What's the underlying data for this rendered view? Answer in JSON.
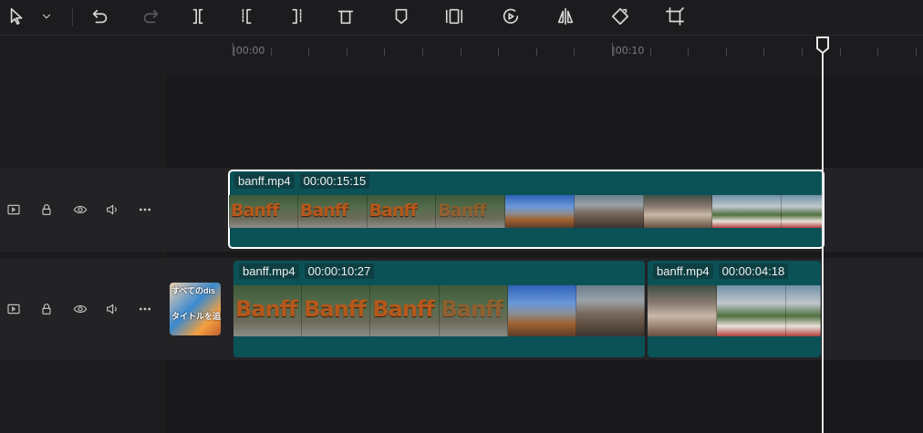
{
  "toolbar": {
    "icons": [
      "select-pointer-icon",
      "chevron-down-icon",
      "undo-icon",
      "redo-icon",
      "split-icon",
      "trim-left-icon",
      "trim-right-icon",
      "delete-icon",
      "marker-icon",
      "freeze-frame-icon",
      "reverse-icon",
      "mirror-icon",
      "rotate-icon",
      "crop-icon"
    ]
  },
  "ruler": {
    "labels": [
      "|00:00",
      "|00:10"
    ]
  },
  "tracks": [
    {
      "clips": [
        {
          "name": "banff.mp4",
          "duration": "00:00:15:15",
          "selected": true
        }
      ]
    },
    {
      "cover_text_1": "すべてのdis",
      "cover_text_2": "タイトルを追加",
      "clips": [
        {
          "name": "banff.mp4",
          "duration": "00:00:10:27",
          "selected": false
        },
        {
          "name": "banff.mp4",
          "duration": "00:00:04:18",
          "selected": false
        }
      ]
    }
  ],
  "thumb_text": "Banff",
  "colors": {
    "clip_bg": "#0b5257",
    "playhead": "#e8e8e8",
    "selection_outline": "#ffffff"
  }
}
